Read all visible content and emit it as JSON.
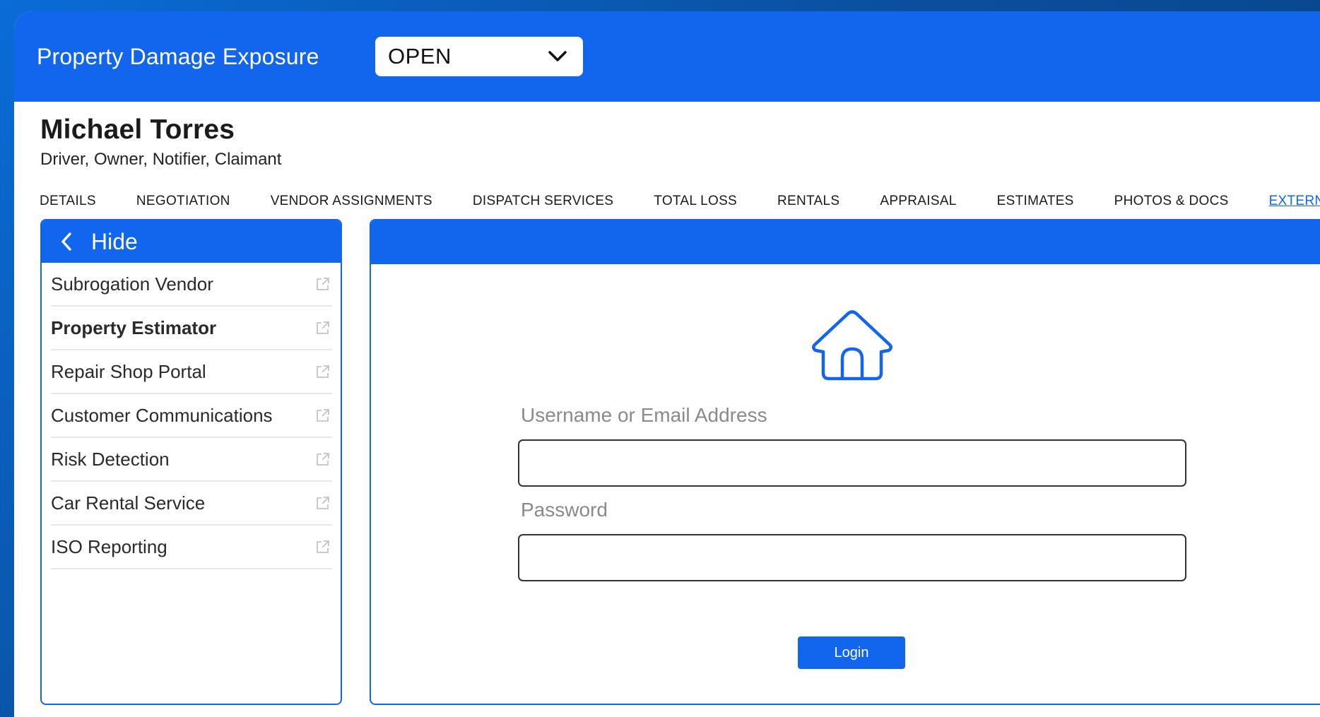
{
  "header": {
    "title": "Property Damage Exposure",
    "status": {
      "selected": "OPEN",
      "icon": "chevron-down-icon"
    }
  },
  "person": {
    "name": "Michael Torres",
    "roles": "Driver, Owner, Notifier, Claimant"
  },
  "tabs": [
    {
      "label": "DETAILS"
    },
    {
      "label": "NEGOTIATION"
    },
    {
      "label": "VENDOR ASSIGNMENTS"
    },
    {
      "label": "DISPATCH SERVICES"
    },
    {
      "label": "TOTAL LOSS"
    },
    {
      "label": "RENTALS"
    },
    {
      "label": "APPRAISAL"
    },
    {
      "label": "ESTIMATES"
    },
    {
      "label": "PHOTOS & DOCS"
    },
    {
      "label": "EXTERNAL LINKS",
      "active": true
    }
  ],
  "sidebar": {
    "hide_label": "Hide",
    "back_icon": "chevron-left-icon",
    "items": [
      {
        "label": "Subrogation Vendor",
        "icon": "external-link-icon"
      },
      {
        "label": "Property Estimator",
        "icon": "external-link-icon",
        "selected": true
      },
      {
        "label": "Repair Shop Portal",
        "icon": "external-link-icon"
      },
      {
        "label": "Customer Communications",
        "icon": "external-link-icon"
      },
      {
        "label": "Risk Detection",
        "icon": "external-link-icon"
      },
      {
        "label": "Car Rental Service",
        "icon": "external-link-icon"
      },
      {
        "label": "ISO Reporting",
        "icon": "external-link-icon"
      }
    ]
  },
  "login": {
    "icon": "house-icon",
    "username_label": "Username or Email Address",
    "username_value": "",
    "password_label": "Password",
    "password_value": "",
    "button_label": "Login"
  },
  "colors": {
    "primary": "#1266ee",
    "background": "#0a4f9e",
    "label_gray": "#8a8a8a"
  }
}
